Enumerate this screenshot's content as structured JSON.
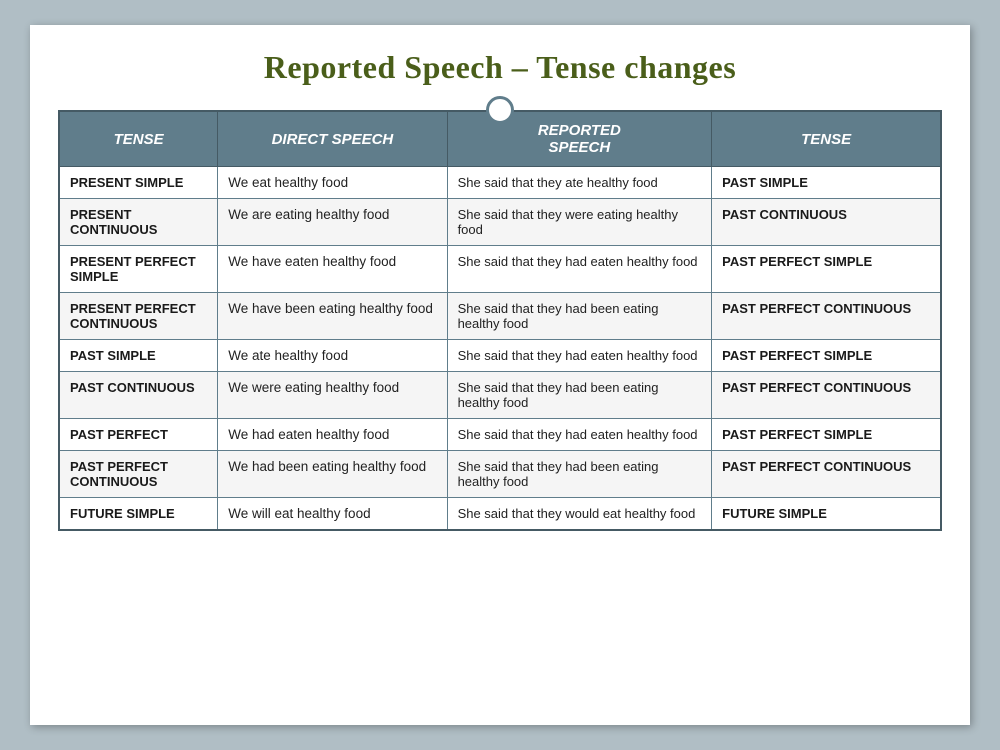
{
  "title": "Reported Speech – Tense changes",
  "table": {
    "headers": [
      "TENSE",
      "DIRECT SPEECH",
      "REPORTED SPEECH",
      "TENSE"
    ],
    "rows": [
      {
        "tense": "PRESENT SIMPLE",
        "direct": "We eat healthy food",
        "reported": "She said that they ate healthy food",
        "result_tense": "PAST SIMPLE"
      },
      {
        "tense": "PRESENT CONTINUOUS",
        "direct": "We are eating healthy food",
        "reported": "She said that they were eating healthy food",
        "result_tense": "PAST CONTINUOUS"
      },
      {
        "tense": "PRESENT PERFECT SIMPLE",
        "direct": "We have eaten healthy food",
        "reported": "She said that they had eaten healthy food",
        "result_tense": "PAST PERFECT SIMPLE"
      },
      {
        "tense": "PRESENT PERFECT CONTINUOUS",
        "direct": "We have been eating healthy food",
        "reported": "She said that they had been eating  healthy food",
        "result_tense": "PAST PERFECT CONTINUOUS"
      },
      {
        "tense": "PAST SIMPLE",
        "direct": "We ate healthy food",
        "reported": "She said that they had eaten healthy food",
        "result_tense": "PAST PERFECT SIMPLE"
      },
      {
        "tense": "PAST CONTINUOUS",
        "direct": "We were eating healthy food",
        "reported": "She said that they had been eating healthy food",
        "result_tense": "PAST PERFECT CONTINUOUS"
      },
      {
        "tense": "PAST PERFECT",
        "direct": "We had eaten healthy food",
        "reported": "She said that they had eaten healthy food",
        "result_tense": "PAST PERFECT SIMPLE"
      },
      {
        "tense": "PAST PERFECT CONTINUOUS",
        "direct": "We had been eating healthy food",
        "reported": "She said that they had been eating  healthy food",
        "result_tense": "PAST PERFECT CONTINUOUS"
      },
      {
        "tense": "FUTURE SIMPLE",
        "direct": "We will eat healthy food",
        "reported": "She said that they would eat healthy food",
        "result_tense": "FUTURE SIMPLE"
      }
    ]
  }
}
